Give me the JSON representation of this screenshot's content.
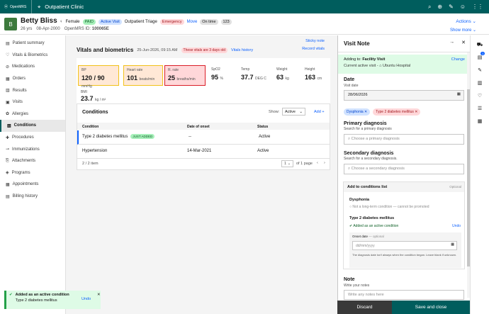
{
  "topbar": {
    "logo": "OpenMRS",
    "location": "Outpatient Clinic"
  },
  "patient": {
    "initial": "B",
    "name": "Betty Bliss",
    "gender": "Female",
    "tags": [
      "PAID",
      "Active Visit",
      "Outpatient Triage",
      "Emergency"
    ],
    "move": "Move",
    "on_time": "On time",
    "count": "123",
    "age": "26 yrs",
    "dob": "08-Apr-2000",
    "id_label": "OpenMRS ID:",
    "id_value": "100065E",
    "actions": "Actions",
    "show_more": "Show more"
  },
  "sidebar": {
    "items": [
      "Patient summary",
      "Vitals & Biometrics",
      "Medications",
      "Orders",
      "Results",
      "Visits",
      "Allergies",
      "Conditions",
      "Procedures",
      "Immunizations",
      "Attachments",
      "Programs",
      "Appointments",
      "Billing history"
    ],
    "active": "Conditions"
  },
  "vitals": {
    "title": "Vitals and biometrics",
    "date": "25-Jun-2026, 09:15 AM",
    "warning": "These vitals are 3 days old",
    "history": "Vitals history",
    "sticky": "Sticky note",
    "record": "Record vitals",
    "cells": [
      {
        "label": "BP",
        "value": "120 / 90",
        "unit": "mmHg"
      },
      {
        "label": "Heart rate",
        "value": "101",
        "unit": "beats/min"
      },
      {
        "label": "R. rate",
        "value": "25",
        "unit": "breaths/min"
      },
      {
        "label": "SpO2",
        "value": "95",
        "unit": "%"
      },
      {
        "label": "Temp",
        "value": "37.7",
        "unit": "DEG C"
      },
      {
        "label": "Weight",
        "value": "63",
        "unit": "kg"
      },
      {
        "label": "Height",
        "value": "163",
        "unit": "cm"
      },
      {
        "label": "BMI",
        "value": "23.7",
        "unit": "kg / m²"
      }
    ]
  },
  "conditions": {
    "title": "Conditions",
    "show_label": "Show:",
    "filter": "Active",
    "add": "Add",
    "headers": [
      "Condition",
      "Date of onset",
      "Status"
    ],
    "rows": [
      {
        "name": "Type 2 diabetes mellitus",
        "badge": "JUST ADDED",
        "onset": "--",
        "status": "Active"
      },
      {
        "name": "Hypertension",
        "badge": "",
        "onset": "14-Mar-2021",
        "status": "Active"
      }
    ],
    "items_count": "2 / 2 item",
    "page": "1",
    "page_of": "of 1 page"
  },
  "visit_note": {
    "title": "Visit Note",
    "facility": {
      "adding_label": "Adding to:",
      "adding_value": "Facility Visit",
      "current_label": "Current active visit -",
      "current_value": "Ubuntu Hospital",
      "change": "Change"
    },
    "date_title": "Date",
    "date_sub": "Visit date",
    "date_value": "28/06/2026",
    "chips": [
      "Dysphonia",
      "Type 2 diabetes mellitus"
    ],
    "primary_title": "Primary diagnosis",
    "primary_sub": "Search for a primary diagnosis",
    "primary_placeholder": "Choose a primary diagnosis",
    "secondary_title": "Secondary diagnosis",
    "secondary_sub": "Search for a secondary diagnosis.",
    "secondary_placeholder": "Choose a secondary diagnosis",
    "add_to_list": {
      "title": "Add to conditions list",
      "optional": "Optional",
      "item1": "Dysphonia",
      "item1_note": "Not a long-term condition — cannot be promoted",
      "item2": "Type 2 diabetes mellitus",
      "item2_note": "Added as an active condition",
      "undo": "Undo",
      "onset_label": "Onset date",
      "onset_optional": "— optional",
      "onset_placeholder": "dd/mm/yyyy",
      "onset_help": "The diagnosis date isn't always when the condition began. Leave blank if unknown."
    },
    "note_title": "Note",
    "note_sub": "Write your notes",
    "note_placeholder": "Write any notes here",
    "discard": "Discard",
    "save": "Save and close"
  },
  "toast": {
    "title": "Added as an active condition",
    "subtitle": "Type 2 diabetes mellitus",
    "undo": "Undo"
  },
  "rail": {
    "badge": "1"
  },
  "colors": {
    "brand": "#005d5d",
    "link": "#0f62fe",
    "success": "#24a148",
    "danger": "#da1e28"
  }
}
